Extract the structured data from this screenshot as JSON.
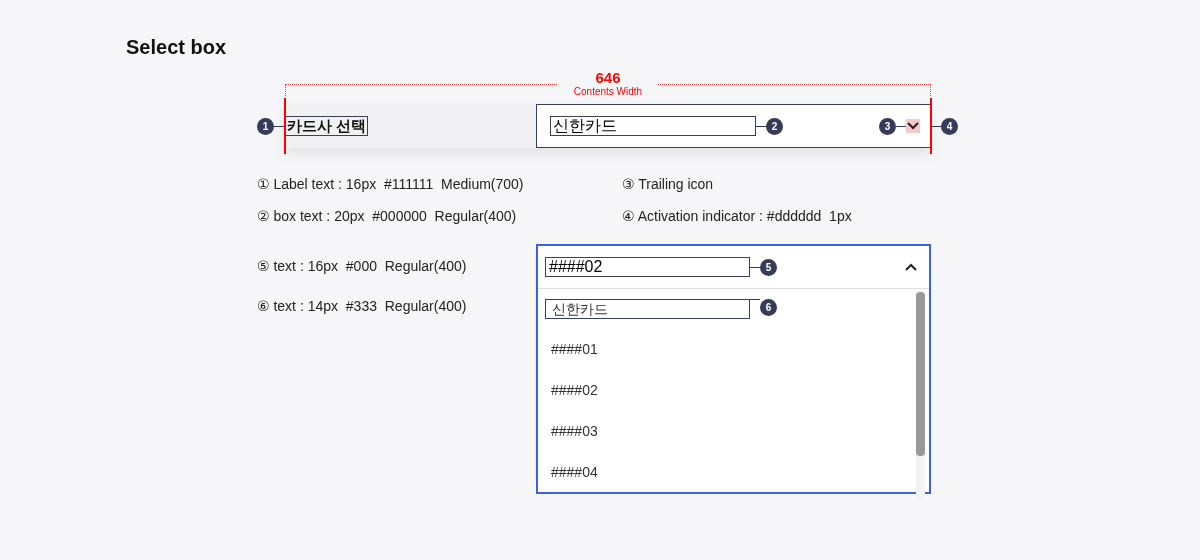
{
  "title": "Select box",
  "dimension": {
    "value": "646",
    "caption": "Contents Width"
  },
  "select_row": {
    "label": "카드사 선택",
    "label_badge": "1",
    "value": "신한카드",
    "value_badge": "2",
    "icon_badge": "3",
    "indicator_badge": "4",
    "expanded": false
  },
  "notes": [
    {
      "marker": "①",
      "text": "Label text : 16px  #111111  Medium(700)"
    },
    {
      "marker": "③",
      "text": "Trailing icon"
    },
    {
      "marker": "②",
      "text": "box text : 20px  #000000  Regular(400)"
    },
    {
      "marker": "④",
      "text": "Activation indicator : #dddddd  1px"
    }
  ],
  "dropdown": {
    "value": "####02",
    "value_badge": "5",
    "expanded": true,
    "notes": [
      {
        "marker": "⑤",
        "text": "text : 16px  #000  Regular(400)"
      },
      {
        "marker": "⑥",
        "text": "text : 14px  #333  Regular(400)"
      }
    ],
    "options": [
      {
        "label": "신한카드",
        "badge": "6"
      },
      {
        "label": "####01"
      },
      {
        "label": "####02"
      },
      {
        "label": "####03"
      },
      {
        "label": "####04"
      }
    ]
  }
}
